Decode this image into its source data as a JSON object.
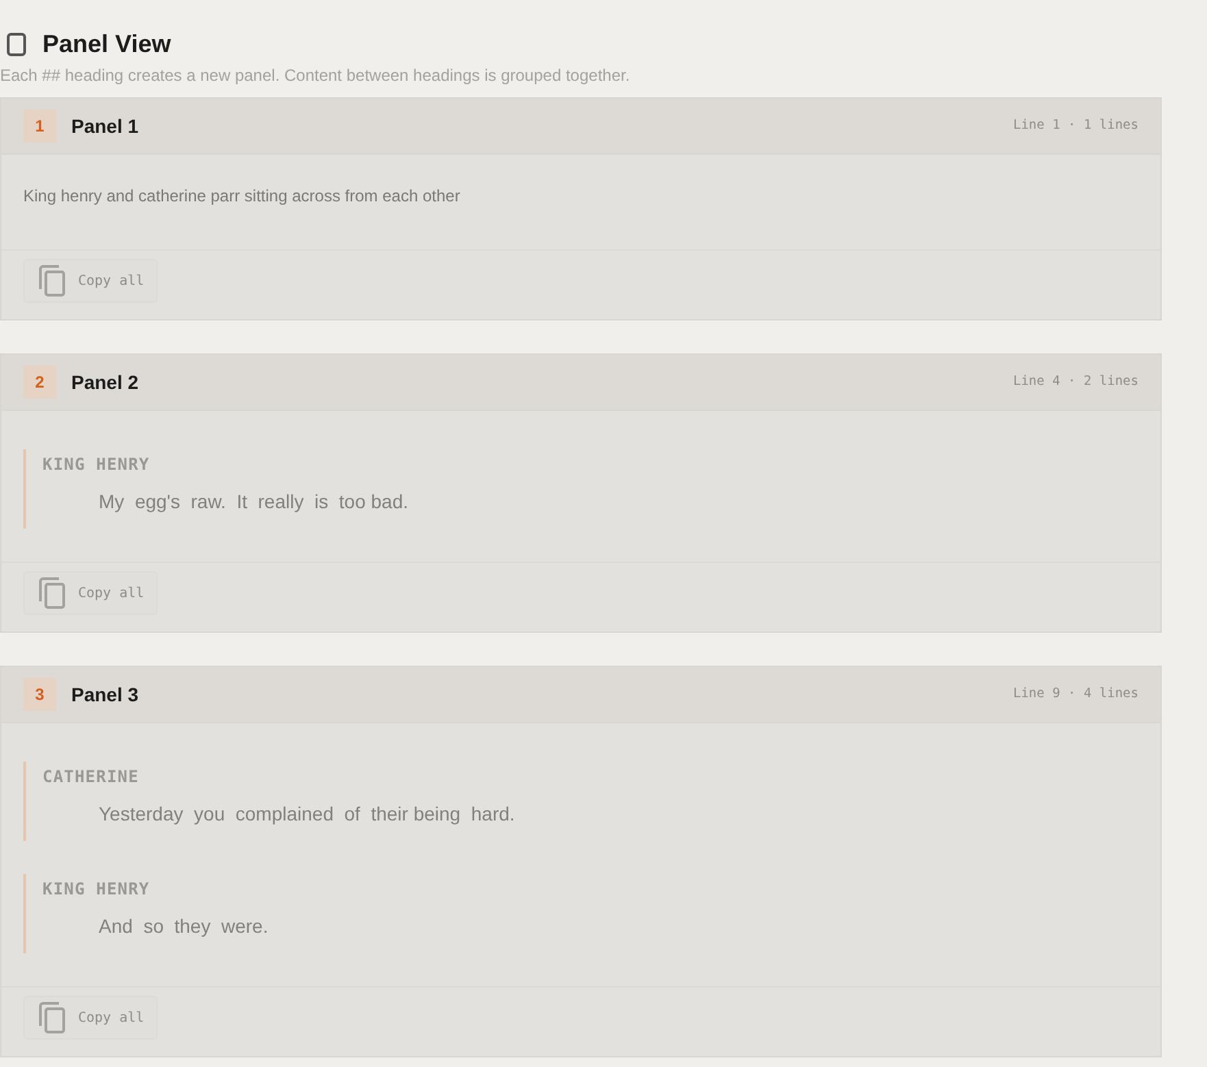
{
  "header": {
    "title": "Panel View",
    "subtitle": "Each ## heading creates a new panel. Content between headings is grouped together."
  },
  "panels": [
    {
      "number": "1",
      "title": "Panel 1",
      "meta": "Line 1 · 1 lines",
      "content": [
        {
          "kind": "paragraph",
          "text": "King henry and catherine parr sitting across from each other"
        }
      ],
      "copy_button": "Copy all"
    },
    {
      "number": "2",
      "title": "Panel 2",
      "meta": "Line 4 · 2 lines",
      "content": [
        {
          "kind": "dialogue",
          "character": "KING HENRY",
          "line": "My  egg's  raw.  It  really  is  too bad."
        }
      ],
      "copy_button": "Copy all"
    },
    {
      "number": "3",
      "title": "Panel 3",
      "meta": "Line 9 · 4 lines",
      "content": [
        {
          "kind": "dialogue",
          "character": "CATHERINE",
          "line": "Yesterday  you  complained  of  their being  hard."
        },
        {
          "kind": "dialogue",
          "character": "KING HENRY",
          "line": "And  so  they  were."
        }
      ],
      "copy_button": "Copy all"
    }
  ]
}
